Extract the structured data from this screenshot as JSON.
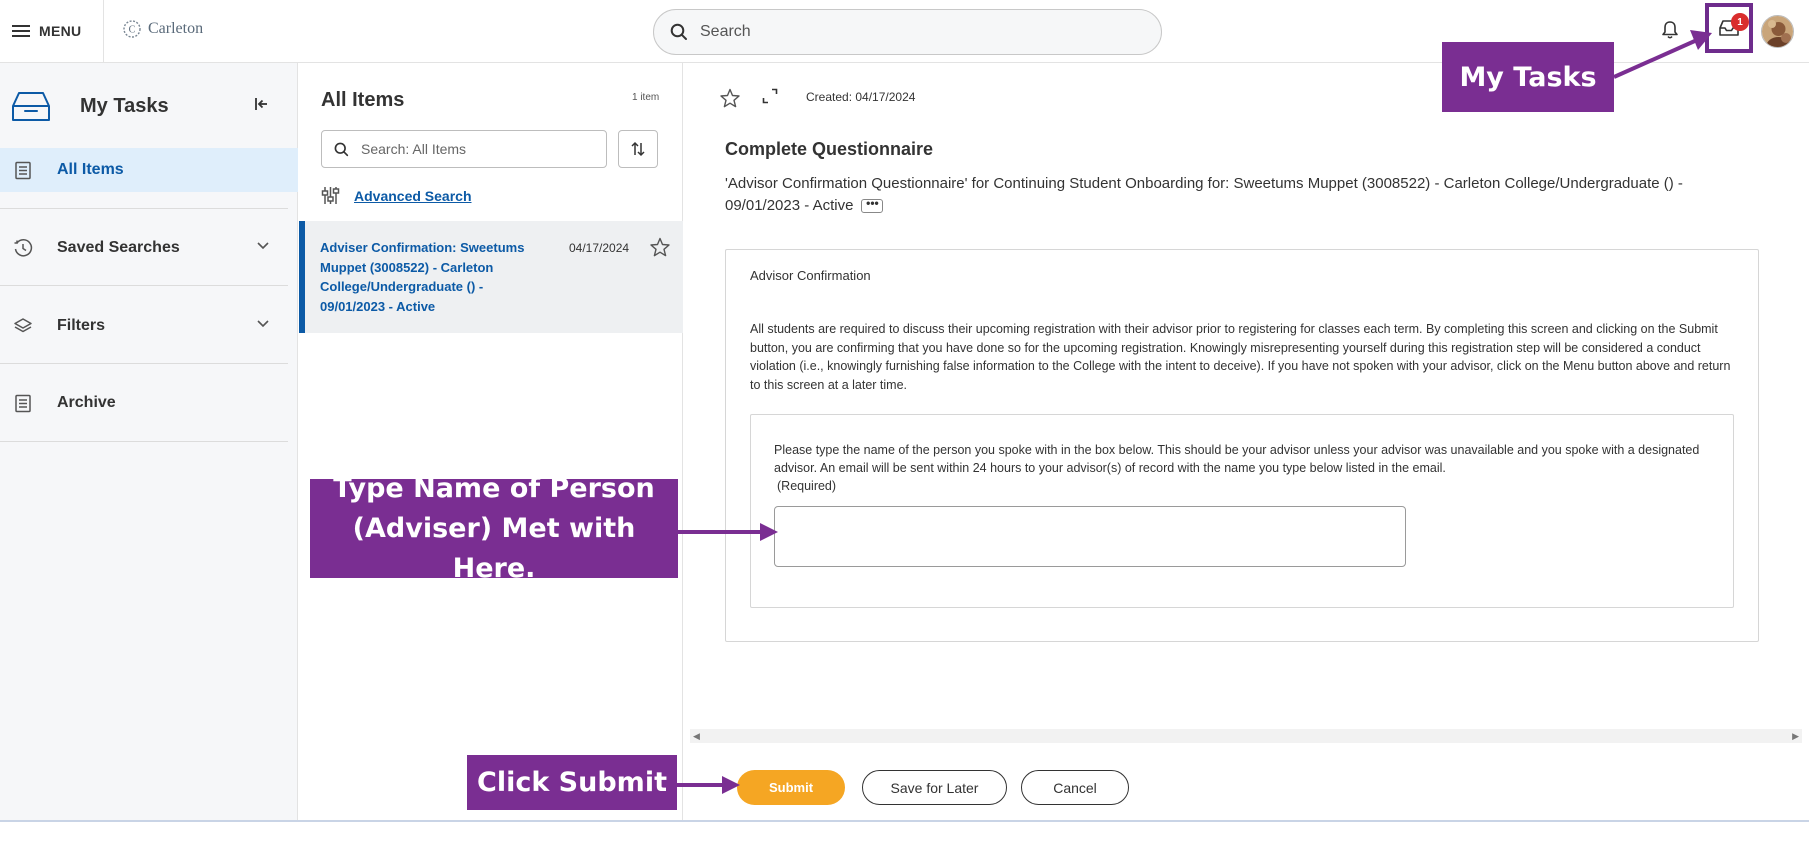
{
  "topbar": {
    "menu_label": "MENU",
    "logo_text": "Carleton",
    "search_placeholder": "Search",
    "notification_badge": "1"
  },
  "sidebar": {
    "title": "My Tasks",
    "items": [
      {
        "label": "All Items",
        "icon": "clipboard-icon",
        "active": true
      },
      {
        "label": "Saved Searches",
        "icon": "history-icon",
        "expandable": true
      },
      {
        "label": "Filters",
        "icon": "layers-icon",
        "expandable": true
      },
      {
        "label": "Archive",
        "icon": "clipboard-icon"
      }
    ]
  },
  "list": {
    "title": "All Items",
    "count": "1 item",
    "search_placeholder": "Search: All Items",
    "advanced_search": "Advanced Search",
    "items": [
      {
        "title": "Adviser Confirmation: Sweetums Muppet (3008522) - Carleton College/Undergraduate () - 09/01/2023 - Active",
        "date": "04/17/2024"
      }
    ]
  },
  "detail": {
    "created": "Created: 04/17/2024",
    "heading": "Complete Questionnaire",
    "subtitle": "'Advisor Confirmation Questionnaire' for Continuing Student Onboarding for: Sweetums Muppet (3008522) - Carleton College/Undergraduate () - 09/01/2023 - Active",
    "more_button": "•••",
    "card": {
      "title": "Advisor Confirmation",
      "paragraph": "All students are required to discuss their upcoming registration with their advisor prior to registering for classes each term. By completing this screen and clicking on the Submit button, you are confirming that you have done so for the upcoming registration. Knowingly misrepresenting yourself during this registration step will be considered a conduct violation (i.e., knowingly furnishing false information to the College with the intent to deceive). If you have not spoken with your advisor, click on the Menu button above and return to this screen at a later time.",
      "question": "Please type the name of the person you spoke with in the box below. This should be your advisor unless your advisor was unavailable and you spoke with a designated advisor. An email will be sent within 24 hours to your advisor(s) of record with the name you type below listed in the email.",
      "required": "(Required)",
      "answer_value": ""
    },
    "buttons": {
      "submit": "Submit",
      "save_for_later": "Save for Later",
      "cancel": "Cancel"
    }
  },
  "callouts": {
    "name_hint_line1": "Type Name of Person",
    "name_hint_line2": "(Adviser) Met with Here.",
    "submit_hint": "Click Submit",
    "tasks_hint": "My Tasks"
  },
  "colors": {
    "accent_blue": "#0c5aa6",
    "callout_purple": "#7a2e92",
    "submit_orange": "#f5a623",
    "badge_red": "#d92d2d"
  }
}
